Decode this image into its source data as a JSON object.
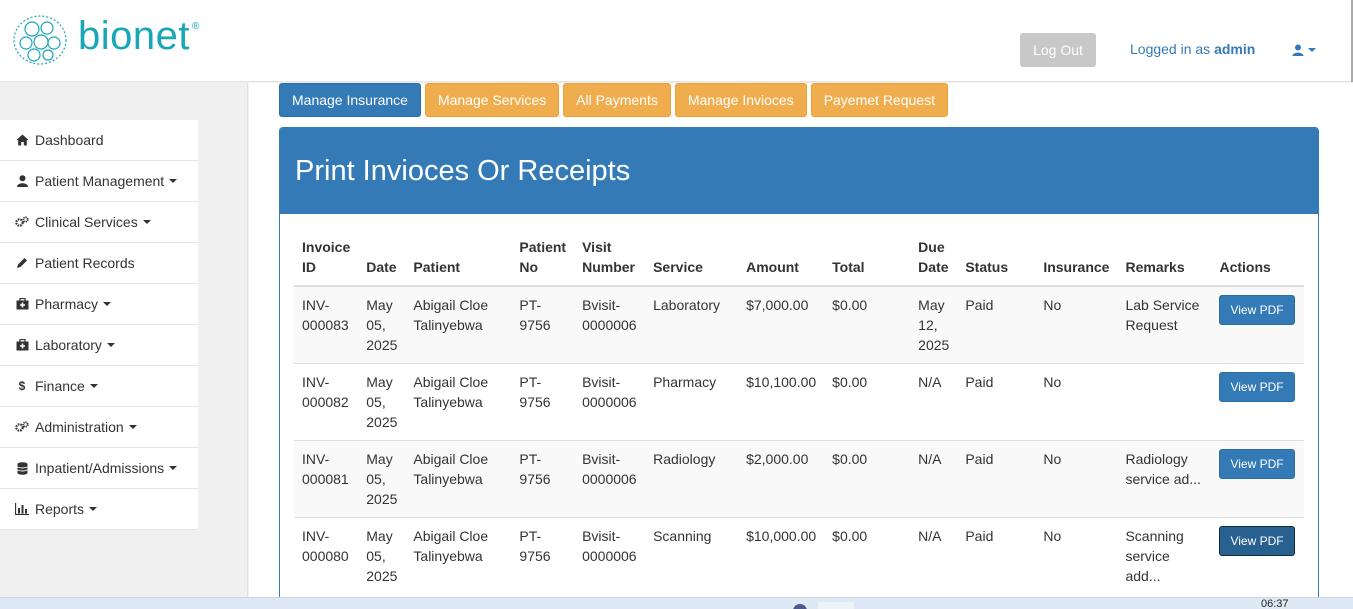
{
  "brand": {
    "name": "bionet",
    "reg": "®",
    "color": "#19a6b6"
  },
  "header": {
    "logout_label": "Log Out",
    "logged_in_prefix": "Logged in as",
    "username": "admin",
    "user_icon": "user-icon"
  },
  "sidebar": {
    "items": [
      {
        "label": "Dashboard",
        "icon": "home-icon",
        "dropdown": false
      },
      {
        "label": "Patient Management",
        "icon": "user-icon",
        "dropdown": true
      },
      {
        "label": "Clinical Services",
        "icon": "cogs-icon",
        "dropdown": true
      },
      {
        "label": "Patient Records",
        "icon": "pencil-icon",
        "dropdown": false
      },
      {
        "label": "Pharmacy",
        "icon": "medkit-icon",
        "dropdown": true
      },
      {
        "label": "Laboratory",
        "icon": "medkit-icon",
        "dropdown": true
      },
      {
        "label": "Finance",
        "icon": "dollar-icon",
        "dropdown": true
      },
      {
        "label": "Administration",
        "icon": "cogs-icon",
        "dropdown": true
      },
      {
        "label": "Inpatient/Admissions",
        "icon": "database-icon",
        "dropdown": true
      },
      {
        "label": "Reports",
        "icon": "bar-chart-icon",
        "dropdown": true
      }
    ]
  },
  "tabs": [
    {
      "label": "Manage Insurance",
      "style": "primary"
    },
    {
      "label": "Manage Services",
      "style": "warning"
    },
    {
      "label": "All Payments",
      "style": "warning"
    },
    {
      "label": "Manage Invioces",
      "style": "warning"
    },
    {
      "label": "Payemet Request",
      "style": "warning"
    }
  ],
  "panel": {
    "title": "Print Invioces Or Receipts"
  },
  "table": {
    "headers": {
      "invoice_id": [
        "Invoice",
        "ID"
      ],
      "date": "Date",
      "patient": "Patient",
      "patient_no": [
        "Patient",
        "No"
      ],
      "visit_number": [
        "Visit",
        "Number"
      ],
      "service": "Service",
      "amount": "Amount",
      "total": "Total",
      "due_date": [
        "Due",
        "Date"
      ],
      "status": "Status",
      "insurance": "Insurance",
      "remarks": "Remarks",
      "actions": "Actions"
    },
    "rows": [
      {
        "invoice_id": [
          "INV-",
          "000083"
        ],
        "date": [
          "May",
          "05,",
          "2025"
        ],
        "patient": [
          "Abigail Cloe",
          "Talinyebwa"
        ],
        "patient_no": [
          "PT-",
          "9756"
        ],
        "visit_number": [
          "Bvisit-",
          "0000006"
        ],
        "service": "Laboratory",
        "amount": "$7,000.00",
        "total": "$0.00",
        "due_date": [
          "May",
          "12,",
          "2025"
        ],
        "status": "Paid",
        "insurance": "No",
        "remarks": [
          "Lab Service",
          "Request"
        ],
        "action_label": "View PDF"
      },
      {
        "invoice_id": [
          "INV-",
          "000082"
        ],
        "date": [
          "May",
          "05,",
          "2025"
        ],
        "patient": [
          "Abigail Cloe",
          "Talinyebwa"
        ],
        "patient_no": [
          "PT-",
          "9756"
        ],
        "visit_number": [
          "Bvisit-",
          "0000006"
        ],
        "service": "Pharmacy",
        "amount": "$10,100.00",
        "total": "$0.00",
        "due_date": [
          "N/A"
        ],
        "status": "Paid",
        "insurance": "No",
        "remarks": [],
        "action_label": "View PDF"
      },
      {
        "invoice_id": [
          "INV-",
          "000081"
        ],
        "date": [
          "May",
          "05,",
          "2025"
        ],
        "patient": [
          "Abigail Cloe",
          "Talinyebwa"
        ],
        "patient_no": [
          "PT-",
          "9756"
        ],
        "visit_number": [
          "Bvisit-",
          "0000006"
        ],
        "service": "Radiology",
        "amount": "$2,000.00",
        "total": "$0.00",
        "due_date": [
          "N/A"
        ],
        "status": "Paid",
        "insurance": "No",
        "remarks": [
          "Radiology",
          "service ad..."
        ],
        "action_label": "View PDF"
      },
      {
        "invoice_id": [
          "INV-",
          "000080"
        ],
        "date": [
          "May",
          "05,",
          "2025"
        ],
        "patient": [
          "Abigail Cloe",
          "Talinyebwa"
        ],
        "patient_no": [
          "PT-",
          "9756"
        ],
        "visit_number": [
          "Bvisit-",
          "0000006"
        ],
        "service": "Scanning",
        "amount": "$10,000.00",
        "total": "$0.00",
        "due_date": [
          "N/A"
        ],
        "status": "Paid",
        "insurance": "No",
        "remarks": [
          "Scanning",
          "service",
          "add..."
        ],
        "action_label": "View PDF"
      }
    ]
  },
  "taskbar": {
    "clock": "06:37"
  },
  "colors": {
    "primary": "#337ab7",
    "warning": "#f0ad4e",
    "brand": "#19a6b6"
  }
}
